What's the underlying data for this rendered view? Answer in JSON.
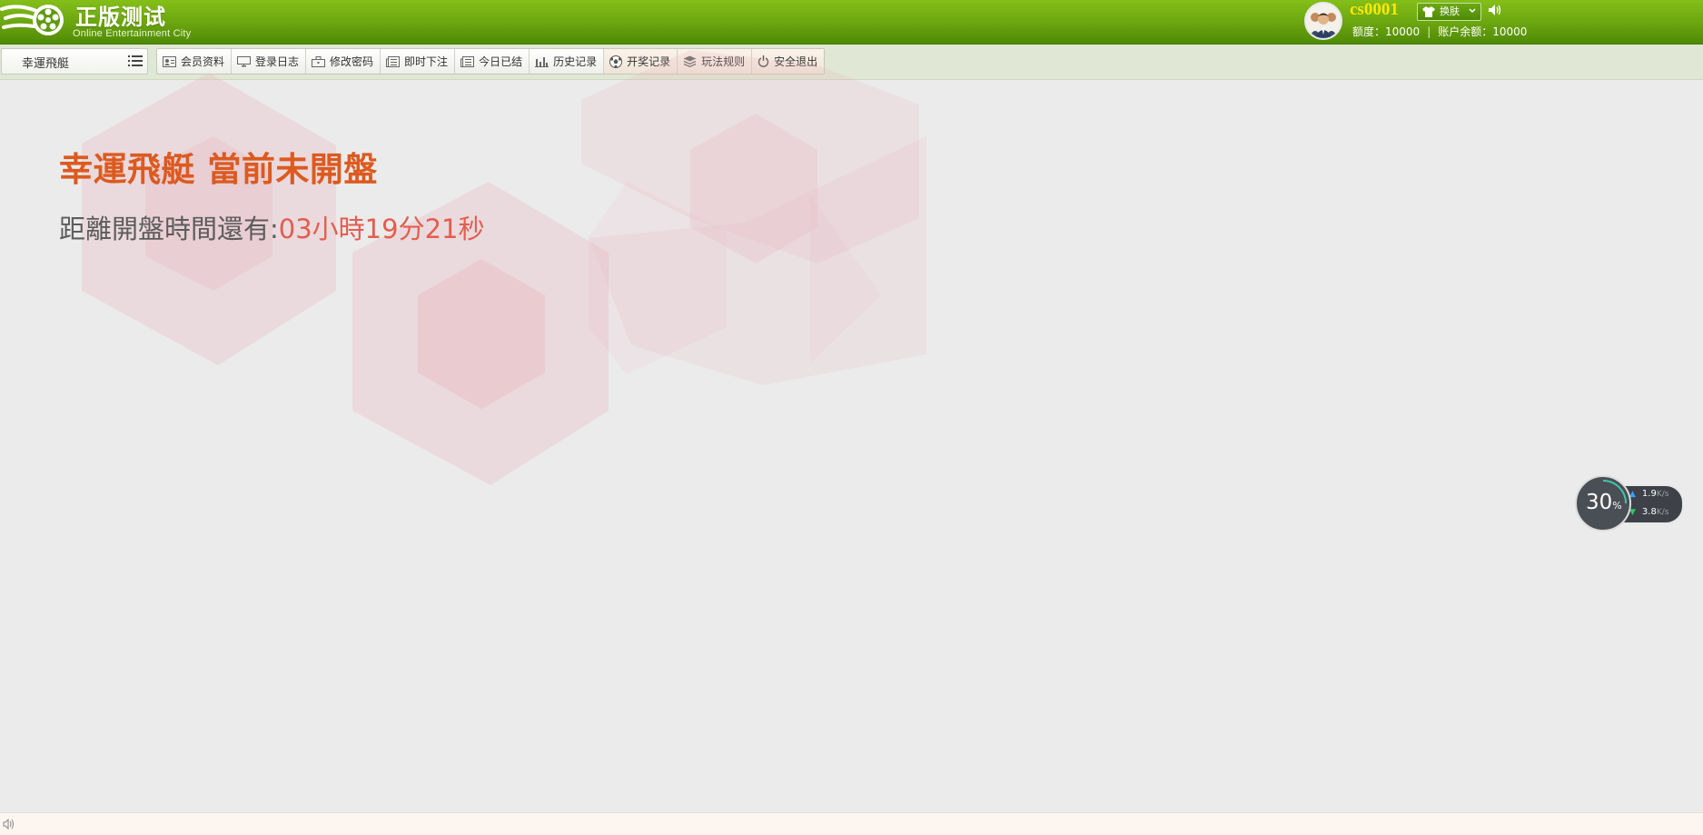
{
  "header": {
    "title": "正版测试",
    "subtitle": "Online Entertainment City",
    "username": "cs0001",
    "skin_label": "换肤",
    "credit_label": "额度：",
    "credit_value": "10000",
    "balance_label": "账户余额：",
    "balance_value": "10000",
    "credit_separator": "|",
    "brand_color": "#6aa40f",
    "username_color": "#ffe700"
  },
  "toolbar": {
    "game_select": "幸運飛艇",
    "menu": [
      {
        "label": "会员资料",
        "icon": "id-card-icon"
      },
      {
        "label": "登录日志",
        "icon": "monitor-icon"
      },
      {
        "label": "修改密码",
        "icon": "briefcase-icon"
      },
      {
        "label": "即时下注",
        "icon": "newspaper-icon"
      },
      {
        "label": "今日已结",
        "icon": "newspaper-icon"
      },
      {
        "label": "历史记录",
        "icon": "bar-chart-icon"
      },
      {
        "label": "开奖记录",
        "icon": "ball-icon"
      },
      {
        "label": "玩法规则",
        "icon": "layers-icon"
      },
      {
        "label": "安全退出",
        "icon": "power-icon"
      }
    ]
  },
  "main": {
    "title": "幸運飛艇 當前未開盤",
    "countdown_label": "距離開盤時間還有:",
    "countdown_value": "03小時19分21秒",
    "title_color": "#dc5a20",
    "countdown_color": "#e45d4f"
  },
  "net_widget": {
    "percent": "30",
    "percent_unit": "%",
    "upload": "1.9",
    "download": "3.8",
    "unit": "K/s"
  }
}
